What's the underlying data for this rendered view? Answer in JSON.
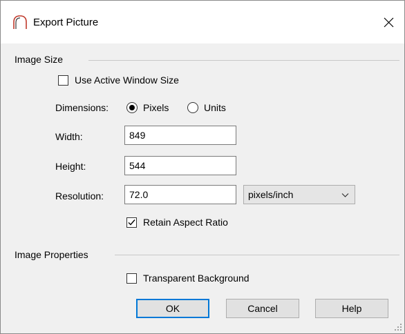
{
  "window": {
    "title": "Export Picture"
  },
  "image_size": {
    "group_label": "Image Size",
    "use_active_window_size": {
      "label": "Use Active Window Size",
      "checked": false
    },
    "dimensions": {
      "label": "Dimensions:",
      "options": [
        {
          "label": "Pixels",
          "selected": true
        },
        {
          "label": "Units",
          "selected": false
        }
      ]
    },
    "width": {
      "label": "Width:",
      "value": "849"
    },
    "height": {
      "label": "Height:",
      "value": "544"
    },
    "resolution": {
      "label": "Resolution:",
      "value": "72.0",
      "unit": "pixels/inch"
    },
    "retain_aspect_ratio": {
      "label": "Retain Aspect Ratio",
      "checked": true
    }
  },
  "image_properties": {
    "group_label": "Image Properties",
    "transparent_background": {
      "label": "Transparent Background",
      "checked": false
    }
  },
  "buttons": {
    "ok": "OK",
    "cancel": "Cancel",
    "help": "Help"
  },
  "icons": {
    "app": "arch-icon",
    "close": "close-icon",
    "dropdown": "chevron-down-icon",
    "check": "checkmark-icon",
    "grip": "resize-grip-icon"
  },
  "colors": {
    "default_button_border": "#0078d7",
    "app_icon": "#c0392b"
  }
}
